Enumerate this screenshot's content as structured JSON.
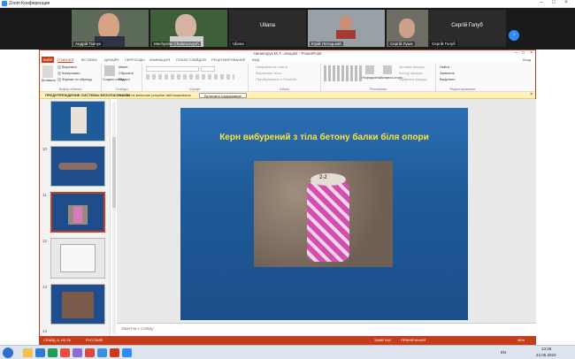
{
  "zoom": {
    "title": "Zoom Конференция",
    "participants": [
      {
        "name": "Андрій Ткачук",
        "muted": false
      },
      {
        "name": "Mechyslav Chaloncovych",
        "muted": false
      },
      {
        "name": "Uliana",
        "muted": true,
        "big": "Uliana"
      },
      {
        "name": "Юрій Лотоцький",
        "muted": true
      },
      {
        "name": "Сергій Лушк",
        "muted": true
      },
      {
        "name": "Сергій Голуб",
        "muted": true,
        "big": "Сергій Голуб"
      }
    ],
    "next_label": "›"
  },
  "ppt": {
    "window_title": "Ничипорук М.Т...лекція2 - PowerPoint",
    "tabs": [
      "ФАЙЛ",
      "ГЛАВНАЯ",
      "ВСТАВКА",
      "ДИЗАЙН",
      "ПЕРЕХОДЫ",
      "АНИМАЦИЯ",
      "ПОКАЗ СЛАЙДОВ",
      "РЕЦЕНЗИРОВАНИЕ",
      "ВИД"
    ],
    "user": "Вход",
    "groups": {
      "clipboard": {
        "label": "Буфер обмена",
        "items": [
          "Вырезать",
          "Копировать",
          "Формат по образцу"
        ],
        "paste": "Вставить"
      },
      "slides": {
        "label": "Слайды",
        "new_slide": "Создать слайд",
        "items": [
          "Макет",
          "Сбросить",
          "Раздел"
        ]
      },
      "font": {
        "label": "Шрифт"
      },
      "paragraph": {
        "label": "Абзац",
        "items": [
          "Направление текста",
          "Выровнять текст",
          "Преобразовать в SmartArt"
        ]
      },
      "drawing": {
        "label": "Рисование",
        "arrange": "Упорядочить",
        "styles": "Экспресс-стили",
        "items": [
          "Заливка фигуры",
          "Контур фигуры",
          "Эффекты фигуры"
        ]
      },
      "editing": {
        "label": "Редактирование",
        "items": [
          "Найти",
          "Заменить",
          "Выделить"
        ]
      }
    },
    "security": {
      "heading": "ПРЕДУПРЕЖДЕНИЕ СИСТЕМЫ БЕЗОПАСНОСТИ",
      "message": "Ссылки на внешние рисунки заблокированы.",
      "button": "Включить содержимое"
    },
    "thumb_numbers": [
      "10",
      "11",
      "12",
      "13",
      "14"
    ],
    "slide_title": "Керн  вибурений  з тіла бетону балки біля опори",
    "photo_text": "2-2",
    "notes_placeholder": "Заметки к слайду",
    "status": {
      "slide": "СЛАЙД 11 ИЗ 26",
      "lang": "РУССКИЙ",
      "notes": "ЗАМЕТКИ",
      "comments": "ПРИМЕЧАНИЯ",
      "zoom": "96%"
    }
  },
  "taskbar": {
    "lang": "EN",
    "time": "13:25",
    "date": "24.05.2023"
  }
}
